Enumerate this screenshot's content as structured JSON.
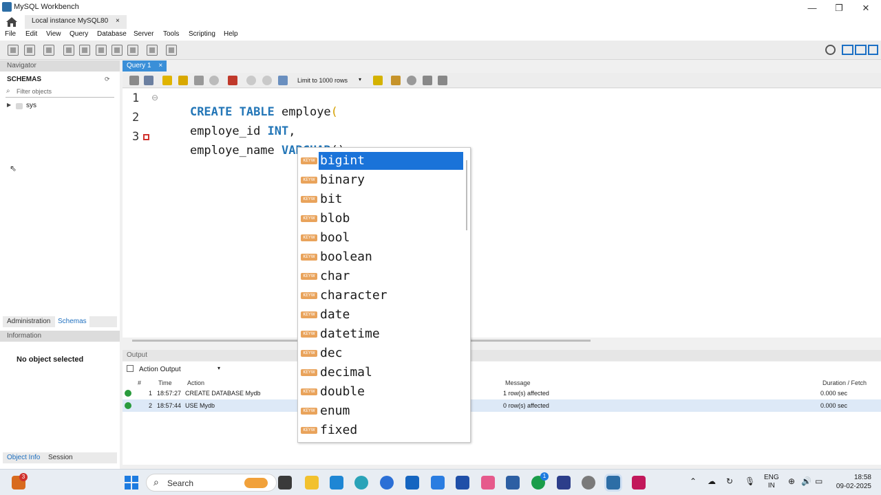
{
  "window": {
    "title": "MySQL Workbench",
    "controls": {
      "minimize": "—",
      "maximize": "❐",
      "close": "✕"
    }
  },
  "connection_tab": {
    "label": "Local instance MySQL80",
    "close": "×"
  },
  "menu": [
    "File",
    "Edit",
    "View",
    "Query",
    "Database",
    "Server",
    "Tools",
    "Scripting",
    "Help"
  ],
  "navigator": {
    "header": "Navigator",
    "schemas_title": "SCHEMAS",
    "filter_placeholder": "Filter objects",
    "schemas": [
      {
        "name": "sys"
      }
    ],
    "tabs": [
      "Administration",
      "Schemas"
    ],
    "information_header": "Information",
    "no_object": "No object selected",
    "bottom_tabs": [
      "Object Info",
      "Session"
    ]
  },
  "query_tab": {
    "label": "Query 1",
    "close": "×"
  },
  "editor_toolbar": {
    "limit_label": "Limit to 1000 rows"
  },
  "editor": {
    "lines": [
      {
        "num": "1",
        "parts": [
          {
            "t": "CREATE TABLE",
            "kw": true
          },
          {
            "t": " employe",
            "kw": false
          },
          {
            "t": "(",
            "kw": false,
            "color": "#d4a000"
          }
        ]
      },
      {
        "num": "2",
        "parts": [
          {
            "t": "employe_id ",
            "kw": false
          },
          {
            "t": "INT",
            "kw": true
          },
          {
            "t": ",",
            "kw": false
          }
        ]
      },
      {
        "num": "3",
        "parts": [
          {
            "t": "employe_name ",
            "kw": false
          },
          {
            "t": "VARCHAR",
            "kw": true
          },
          {
            "t": "();",
            "kw": false
          }
        ]
      }
    ],
    "error_line": "3"
  },
  "autocomplete": {
    "badge": "KEYW",
    "items": [
      "bigint",
      "binary",
      "bit",
      "blob",
      "bool",
      "boolean",
      "char",
      "character",
      "date",
      "datetime",
      "dec",
      "decimal",
      "double",
      "enum",
      "fixed"
    ],
    "selected_index": 0
  },
  "output": {
    "header": "Output",
    "selector": "Action Output",
    "columns": [
      "#",
      "Time",
      "Action",
      "Message",
      "Duration / Fetch"
    ],
    "rows": [
      {
        "num": "1",
        "time": "18:57:27",
        "action": "CREATE DATABASE Mydb",
        "message": "1 row(s) affected",
        "duration": "0.000 sec"
      },
      {
        "num": "2",
        "time": "18:57:44",
        "action": "USE Mydb",
        "message": "0 row(s) affected",
        "duration": "0.000 sec"
      }
    ]
  },
  "taskbar": {
    "search_label": "Search",
    "notif_badge": "3",
    "whatsapp_badge": "1",
    "lang_top": "ENG",
    "lang_bottom": "IN",
    "time": "18:58",
    "date": "09-02-2025"
  }
}
